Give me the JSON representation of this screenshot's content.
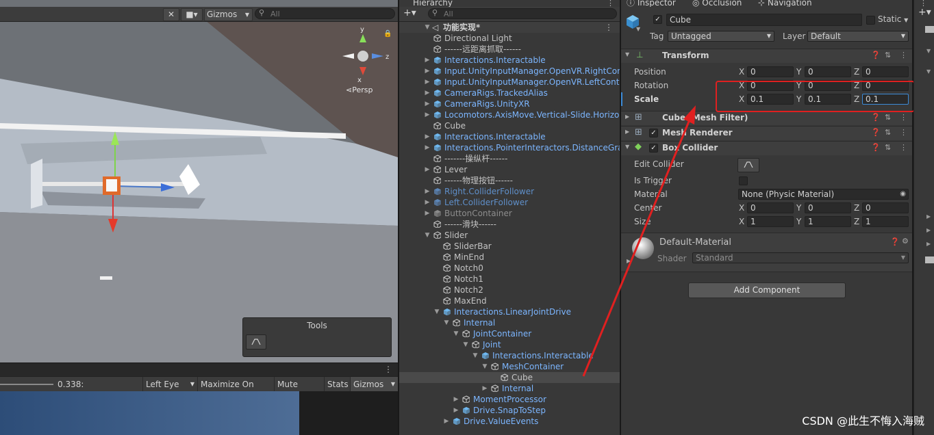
{
  "scene": {
    "toolbar": {
      "tools_icon": "wrench-icon",
      "camera_icon": "camera-icon",
      "gizmos_label": "Gizmos",
      "search_placeholder": "All"
    },
    "gizmo": {
      "y_label": "y",
      "x_label": "x",
      "z_label": "z",
      "persp_label": "⋖Persp"
    },
    "tools_overlay": {
      "title": "Tools",
      "button_icon": "collider-edit-icon"
    }
  },
  "game": {
    "scale_value": "0.338:",
    "eye_select": "Left Eye",
    "maximize_label": "Maximize On Play",
    "mute_label": "Mute Audio",
    "stats_label": "Stats",
    "gizmos_label": "Gizmos"
  },
  "hierarchy": {
    "tab_label": "Hierarchy",
    "search_placeholder": "All",
    "scene_name": "功能实现*",
    "rows": [
      {
        "label": "Directional Light",
        "depth": 1,
        "arrow": "",
        "style": "gray",
        "icon": "cube-outline"
      },
      {
        "label": "------远距离抓取------",
        "depth": 1,
        "arrow": "",
        "style": "gray",
        "icon": "cube-outline"
      },
      {
        "label": "Interactions.Interactable",
        "depth": 1,
        "arrow": "▶",
        "style": "blue",
        "icon": "cube-blue"
      },
      {
        "label": "Input.UnityInputManager.OpenVR.RightCon",
        "depth": 1,
        "arrow": "▶",
        "style": "blue",
        "icon": "cube-blue"
      },
      {
        "label": "Input.UnityInputManager.OpenVR.LeftContr",
        "depth": 1,
        "arrow": "▶",
        "style": "blue",
        "icon": "cube-blue"
      },
      {
        "label": "CameraRigs.TrackedAlias",
        "depth": 1,
        "arrow": "▶",
        "style": "blue",
        "icon": "cube-blue"
      },
      {
        "label": "CameraRigs.UnityXR",
        "depth": 1,
        "arrow": "▶",
        "style": "blue",
        "icon": "cube-blue"
      },
      {
        "label": "Locomotors.AxisMove.Vertical-Slide.Horizo",
        "depth": 1,
        "arrow": "▶",
        "style": "blue",
        "icon": "cube-blue"
      },
      {
        "label": "Cube",
        "depth": 1,
        "arrow": "",
        "style": "gray",
        "icon": "cube-outline"
      },
      {
        "label": "Interactions.Interactable",
        "depth": 1,
        "arrow": "▶",
        "style": "blue",
        "icon": "cube-blue"
      },
      {
        "label": "Interactions.PointerInteractors.DistanceGra",
        "depth": 1,
        "arrow": "▶",
        "style": "blue",
        "icon": "cube-blue"
      },
      {
        "label": "-------操纵杆------",
        "depth": 1,
        "arrow": "",
        "style": "gray",
        "icon": "cube-outline"
      },
      {
        "label": "Lever",
        "depth": 1,
        "arrow": "▶",
        "style": "gray",
        "icon": "cube-outline"
      },
      {
        "label": "------物理按钮------",
        "depth": 1,
        "arrow": "",
        "style": "gray",
        "icon": "cube-outline"
      },
      {
        "label": "Right.ColliderFollower",
        "depth": 1,
        "arrow": "▶",
        "style": "dimblue",
        "icon": "cube-dimblue"
      },
      {
        "label": "Left.ColliderFollower",
        "depth": 1,
        "arrow": "▶",
        "style": "dimblue",
        "icon": "cube-dimblue"
      },
      {
        "label": "ButtonContainer",
        "depth": 1,
        "arrow": "▶",
        "style": "dim",
        "icon": "cube-dim"
      },
      {
        "label": "------滑块------",
        "depth": 1,
        "arrow": "",
        "style": "gray",
        "icon": "cube-outline"
      },
      {
        "label": "Slider",
        "depth": 1,
        "arrow": "▼",
        "style": "gray",
        "icon": "cube-outline"
      },
      {
        "label": "SliderBar",
        "depth": 2,
        "arrow": "",
        "style": "gray",
        "icon": "cube-outline"
      },
      {
        "label": "MinEnd",
        "depth": 2,
        "arrow": "",
        "style": "gray",
        "icon": "cube-outline"
      },
      {
        "label": "Notch0",
        "depth": 2,
        "arrow": "",
        "style": "gray",
        "icon": "cube-outline"
      },
      {
        "label": "Notch1",
        "depth": 2,
        "arrow": "",
        "style": "gray",
        "icon": "cube-outline"
      },
      {
        "label": "Notch2",
        "depth": 2,
        "arrow": "",
        "style": "gray",
        "icon": "cube-outline"
      },
      {
        "label": "MaxEnd",
        "depth": 2,
        "arrow": "",
        "style": "gray",
        "icon": "cube-outline"
      },
      {
        "label": "Interactions.LinearJointDrive",
        "depth": 2,
        "arrow": "▼",
        "style": "blue",
        "icon": "cube-blue"
      },
      {
        "label": "Internal",
        "depth": 3,
        "arrow": "▼",
        "style": "blue",
        "icon": "cube-outline"
      },
      {
        "label": "JointContainer",
        "depth": 4,
        "arrow": "▼",
        "style": "blue",
        "icon": "cube-outline"
      },
      {
        "label": "Joint",
        "depth": 5,
        "arrow": "▼",
        "style": "blue",
        "icon": "cube-outline"
      },
      {
        "label": "Interactions.Interactable",
        "depth": 6,
        "arrow": "▼",
        "style": "blue",
        "icon": "cube-blue"
      },
      {
        "label": "MeshContainer",
        "depth": 7,
        "arrow": "▼",
        "style": "blue",
        "icon": "cube-outline"
      },
      {
        "label": "Cube",
        "depth": 8,
        "arrow": "",
        "style": "gray",
        "icon": "cube-outline",
        "selected": true
      },
      {
        "label": "Internal",
        "depth": 7,
        "arrow": "▶",
        "style": "blue",
        "icon": "cube-outline"
      },
      {
        "label": "MomentProcessor",
        "depth": 4,
        "arrow": "▶",
        "style": "blue",
        "icon": "cube-outline"
      },
      {
        "label": "Drive.SnapToStep",
        "depth": 4,
        "arrow": "▶",
        "style": "blue",
        "icon": "cube-blue"
      },
      {
        "label": "Drive.ValueEvents",
        "depth": 3,
        "arrow": "▶",
        "style": "blue",
        "icon": "cube-blue"
      }
    ]
  },
  "inspector": {
    "tabs": [
      "Inspector",
      "Occlusion",
      "Navigation"
    ],
    "object_name": "Cube",
    "static_label": "Static",
    "tag_label": "Tag",
    "tag_value": "Untagged",
    "layer_label": "Layer",
    "layer_value": "Default",
    "transform": {
      "title": "Transform",
      "position_label": "Position",
      "rotation_label": "Rotation",
      "scale_label": "Scale",
      "position": {
        "x": "0",
        "y": "0",
        "z": "0"
      },
      "rotation": {
        "x": "0",
        "y": "0",
        "z": "0"
      },
      "scale": {
        "x": "0.1",
        "y": "0.1",
        "z": "0.1"
      }
    },
    "mesh_filter_title": "Cube (Mesh Filter)",
    "mesh_renderer_title": "Mesh Renderer",
    "box_collider": {
      "title": "Box Collider",
      "edit_collider_label": "Edit Collider",
      "is_trigger_label": "Is Trigger",
      "material_label": "Material",
      "material_value": "None (Physic Material)",
      "center_label": "Center",
      "size_label": "Size",
      "center": {
        "x": "0",
        "y": "0",
        "z": "0"
      },
      "size": {
        "x": "1",
        "y": "1",
        "z": "1"
      }
    },
    "material": {
      "name": "Default-Material",
      "shader_label": "Shader",
      "shader_value": "Standard"
    },
    "add_component_label": "Add Component",
    "axis_x": "X",
    "axis_y": "Y",
    "axis_z": "Z"
  },
  "watermark": "CSDN @此生不悔入海贼",
  "colors": {
    "annotation_red": "#e02020",
    "link_blue": "#7cb6ff",
    "panel_bg": "#383838"
  }
}
